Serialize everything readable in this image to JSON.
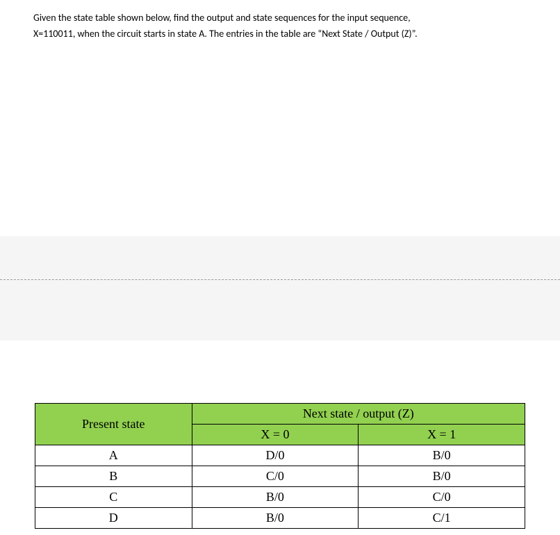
{
  "question": {
    "line1": "Given the state table shown below, find the output and state sequences for the input sequence,",
    "line2": "X=110011, when the circuit starts in state A. The entries in the table are “Next State / Output (Z)”."
  },
  "chart_data": {
    "type": "table",
    "title": "",
    "headers": {
      "present_state": "Present state",
      "next_state": "Next state / output (Z)",
      "x0": "X = 0",
      "x1": "X = 1"
    },
    "rows": [
      {
        "state": "A",
        "x0": "D/0",
        "x1": "B/0"
      },
      {
        "state": "B",
        "x0": "C/0",
        "x1": "B/0"
      },
      {
        "state": "C",
        "x0": "B/0",
        "x1": "C/0"
      },
      {
        "state": "D",
        "x0": "B/0",
        "x1": "C/1"
      }
    ]
  }
}
